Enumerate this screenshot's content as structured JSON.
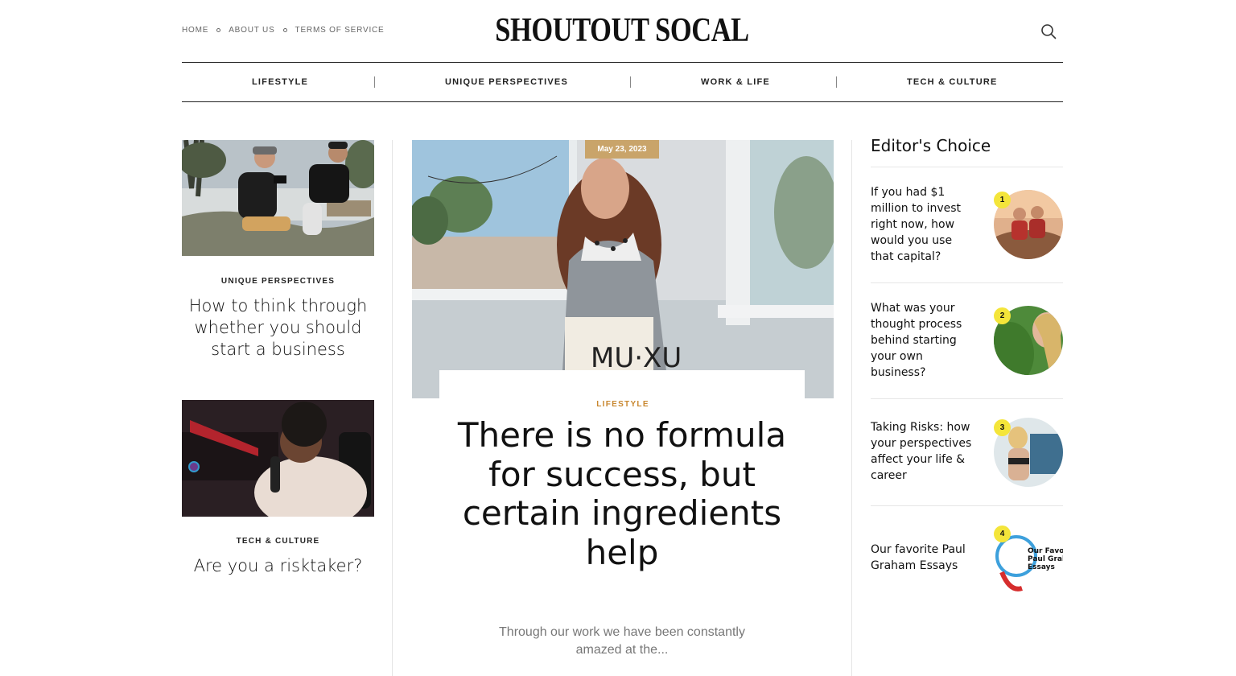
{
  "header": {
    "links": [
      "HOME",
      "ABOUT US",
      "TERMS OF SERVICE"
    ],
    "logo": "SHOUTOUT SOCAL",
    "search_icon": "search-icon"
  },
  "nav": {
    "items": [
      "LIFESTYLE",
      "UNIQUE PERSPECTIVES",
      "WORK & LIFE",
      "TECH & CULTURE"
    ]
  },
  "left_posts": [
    {
      "category": "UNIQUE PERSPECTIVES",
      "title": "How to think through whether you should start a business"
    },
    {
      "category": "TECH & CULTURE",
      "title": "Are you a risktaker?"
    }
  ],
  "featured": {
    "date": "May 23, 2023",
    "bag_text": "MU·XU",
    "category": "LIFESTYLE",
    "title": "There is no formula for success, but certain ingredients help",
    "excerpt": "Through our work we have been constantly amazed at the..."
  },
  "editors_choice": {
    "heading": "Editor's Choice",
    "items": [
      {
        "number": "1",
        "title": "If you had $1 million to invest right now, how would you use that capital?"
      },
      {
        "number": "2",
        "title": "What was your thought process behind starting your own business?"
      },
      {
        "number": "3",
        "title": "Taking Risks: how your perspectives affect your life & career"
      },
      {
        "number": "4",
        "title": "Our favorite Paul Graham Essays",
        "thumb_text": [
          "Our Favo",
          "Paul Grah",
          "Essays"
        ]
      }
    ]
  },
  "colors": {
    "date_badge": "#c9a46a",
    "category_accent": "#c8872f",
    "number_badge": "#f4e53a"
  }
}
